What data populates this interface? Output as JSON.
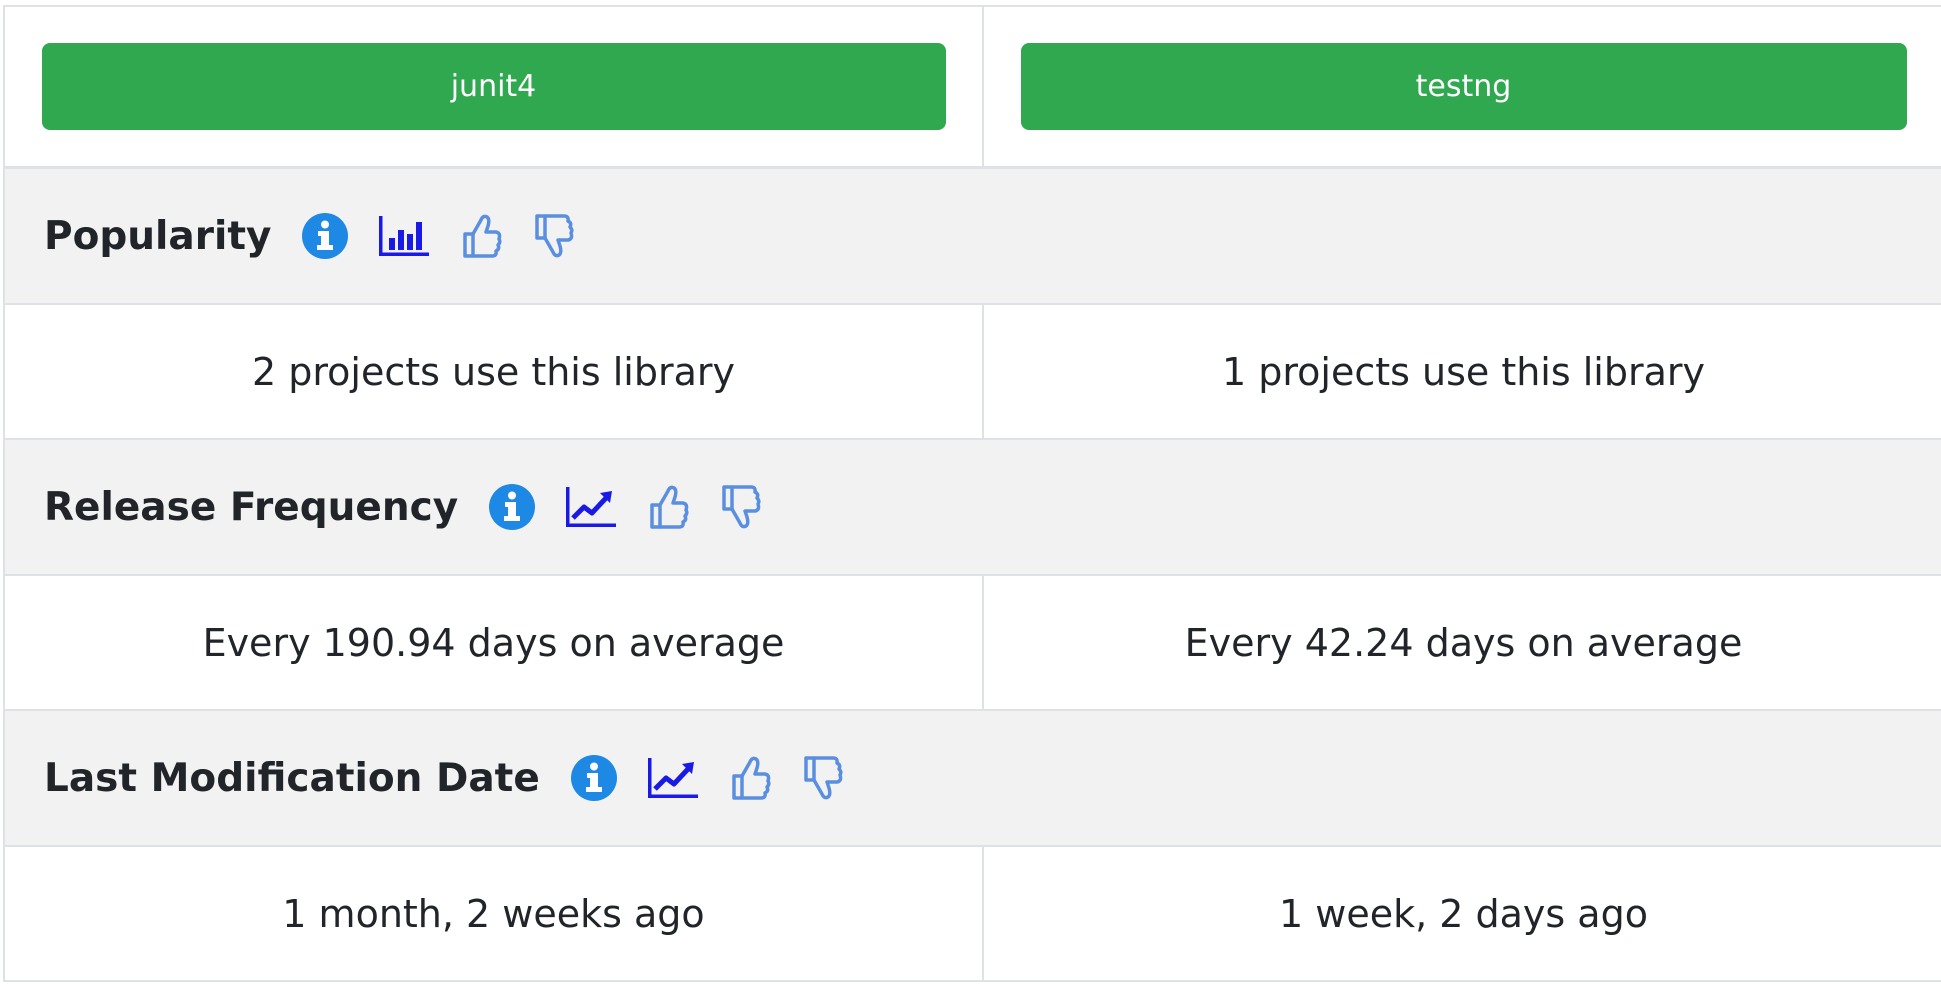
{
  "libraries": [
    {
      "name": "junit4"
    },
    {
      "name": "testng"
    }
  ],
  "sections": [
    {
      "title": "Popularity",
      "chart_icon": "bar-chart-icon",
      "values": [
        "2 projects use this library",
        "1 projects use this library"
      ]
    },
    {
      "title": "Release Frequency",
      "chart_icon": "line-chart-icon",
      "values": [
        "Every 190.94 days on average",
        "Every 42.24 days on average"
      ]
    },
    {
      "title": "Last Modification Date",
      "chart_icon": "line-chart-icon",
      "values": [
        "1 month, 2 weeks ago",
        "1 week, 2 days ago"
      ]
    }
  ],
  "colors": {
    "button_green": "#2fa84f",
    "info_blue": "#1e88e5",
    "chart_blue": "#1a1ae6",
    "thumb_blue": "#5a8fe0",
    "section_bg": "#f2f2f2",
    "border": "#dee2e6"
  }
}
